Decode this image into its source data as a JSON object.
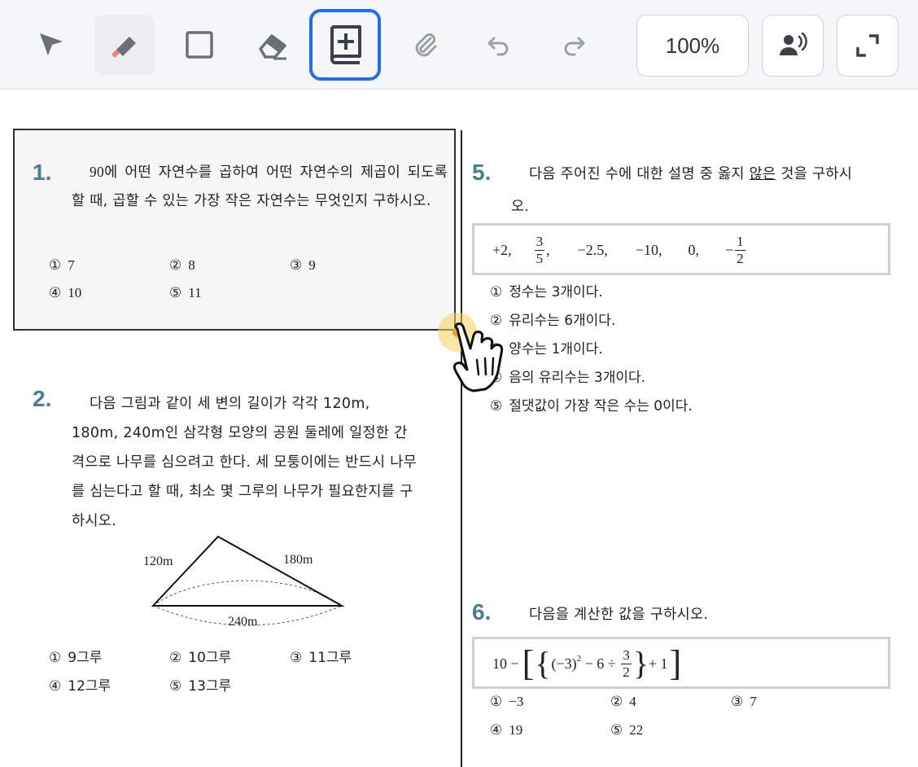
{
  "toolbar": {
    "tools": [
      "select-arrow-icon",
      "pen-icon",
      "rectangle-icon",
      "eraser-icon",
      "add-page-icon",
      "paperclip-icon",
      "undo-icon",
      "redo-icon"
    ],
    "zoom": "100%",
    "colors": {
      "accent": "#1e6ef0",
      "pen_tip": "#f08080",
      "question_number": "#4a7f93"
    }
  },
  "questions": {
    "q1": {
      "number": "1.",
      "value": "90",
      "text_a": "에 어떤 자연수를 곱하여 어떤 자연수의 제곱이 되도록 할 때, 곱할 수 있는 가장 작은 자연수는 무엇인지 구하시오.",
      "options": [
        {
          "mark": "①",
          "text": "7"
        },
        {
          "mark": "②",
          "text": "8"
        },
        {
          "mark": "③",
          "text": "9"
        },
        {
          "mark": "④",
          "text": "10"
        },
        {
          "mark": "⑤",
          "text": "11"
        }
      ]
    },
    "q2": {
      "number": "2.",
      "line1": "다음 그림과 같이 세 변의 길이가 각각 120m,",
      "line2": "180m, 240m인 삼각형 모양의 공원 둘레에 일정한 간",
      "line3": "격으로 나무를 심으려고 한다. 세 모퉁이에는 반드시 나무",
      "line4": "를 심는다고 할 때, 최소 몇 그루의 나무가 필요한지를 구",
      "line5": "하시오.",
      "figure": {
        "left": "120m",
        "right": "180m",
        "bottom": "240m"
      },
      "options": [
        {
          "mark": "①",
          "text": "9그루"
        },
        {
          "mark": "②",
          "text": "10그루"
        },
        {
          "mark": "③",
          "text": "11그루"
        },
        {
          "mark": "④",
          "text": "12그루"
        },
        {
          "mark": "⑤",
          "text": "13그루"
        }
      ]
    },
    "q5": {
      "number": "5.",
      "text_a": "다음 주어진 수에 대한 설명 중 옳지 ",
      "text_underline": "않은",
      "text_b": " 것을 구하시",
      "text_c": "오.",
      "given": {
        "a": "+2,",
        "b_num": "3",
        "b_den": "5",
        "b_comma": ",",
        "c": "−2.5,",
        "d": "−10,",
        "e": "0,",
        "f_sign": "−",
        "f_num": "1",
        "f_den": "2"
      },
      "options": [
        {
          "mark": "①",
          "text": "정수는 3개이다."
        },
        {
          "mark": "②",
          "text": "유리수는 6개이다."
        },
        {
          "mark": "③",
          "text": "양수는 1개이다."
        },
        {
          "mark": "④",
          "text": "음의 유리수는 3개이다."
        },
        {
          "mark": "⑤",
          "text": "절댓값이 가장 작은 수는 0이다."
        }
      ]
    },
    "q6": {
      "number": "6.",
      "text": "다음을 계산한 값을 구하시오.",
      "expr": {
        "p1": "10 −",
        "p2": "(−3)",
        "exp": "2",
        "p3": " − 6 ÷ ",
        "num": "3",
        "den": "2",
        "p4": "+ 1"
      },
      "options": [
        {
          "mark": "①",
          "text": "−3"
        },
        {
          "mark": "②",
          "text": "4"
        },
        {
          "mark": "③",
          "text": "7"
        },
        {
          "mark": "④",
          "text": "19"
        },
        {
          "mark": "⑤",
          "text": "22"
        }
      ]
    }
  }
}
